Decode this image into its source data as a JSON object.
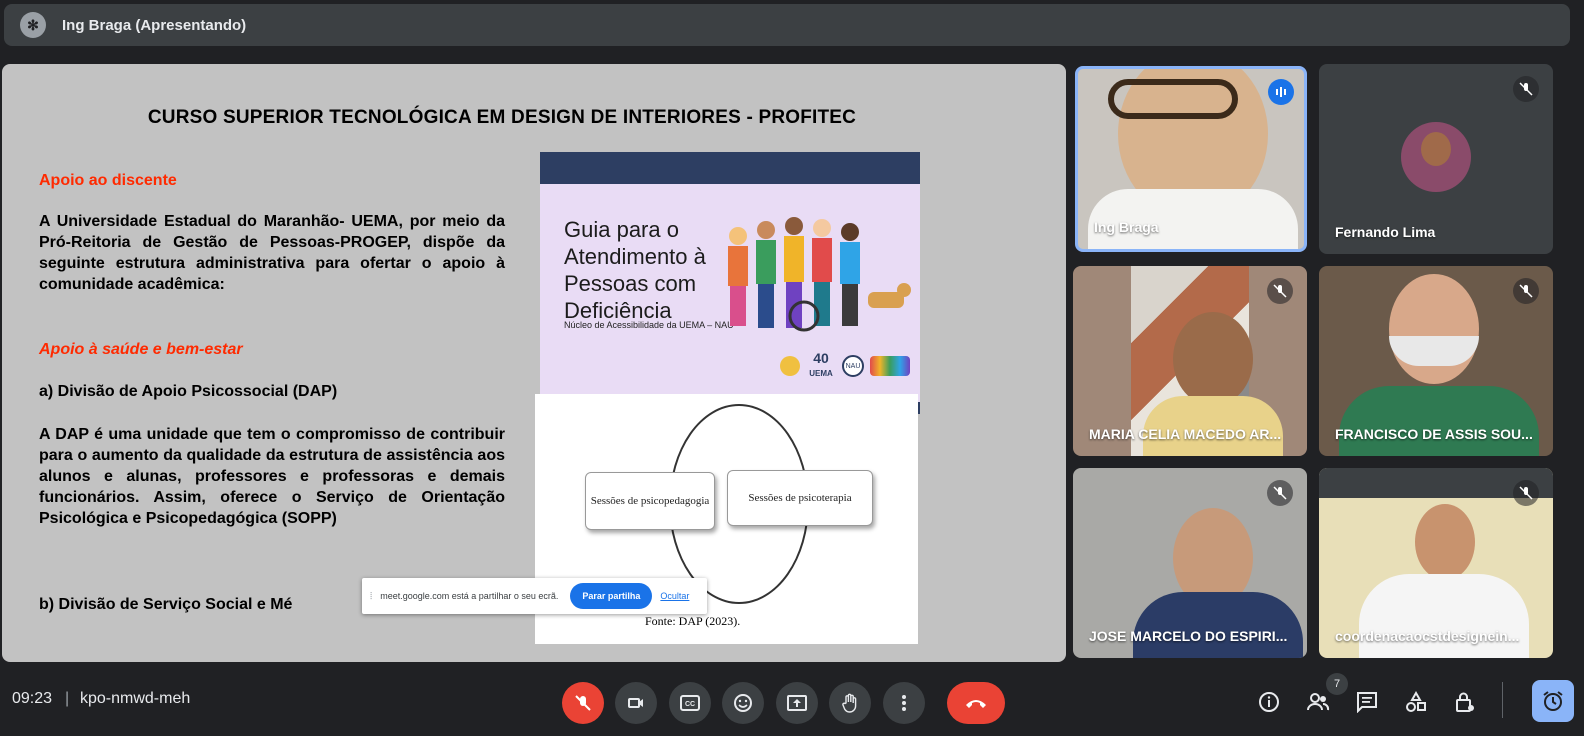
{
  "header": {
    "presenter": "Ing Braga (Apresentando)"
  },
  "slide": {
    "title": "CURSO SUPERIOR TECNOLÓGICA EM DESIGN DE INTERIORES  - PROFITEC",
    "section1": "Apoio ao discente",
    "para1": "A Universidade Estadual do Maranhão- UEMA, por meio da Pró-Reitoria de Gestão de Pessoas-PROGEP, dispõe da seguinte estrutura administrativa para ofertar o apoio à comunidade acadêmica:",
    "section2": "Apoio à saúde e bem-estar",
    "item_a": "a) Divisão de Apoio Psicossocial (DAP)",
    "para2": "A DAP é uma unidade que tem o compromisso de contribuir para o aumento da qualidade da estrutura de assistência aos alunos e alunas, professores e professoras e demais funcionários. Assim, oferece o Serviço de Orientação Psicológica e Psicopedagógica (SOPP)",
    "item_b": "b) Divisão de Serviço Social e Mé",
    "guide_title": "Guia para o\nAtendimento à\nPessoas com\nDeficiência",
    "guide_sub": "Núcleo de Acessibilidade da UEMA – NAU",
    "guide_logo1": "40",
    "guide_logo2": "UEMA",
    "guide_logo3": "NAU",
    "box_left": "Sessões de psicopedagogia",
    "box_right": "Sessões de psicoterapia",
    "fonte": "Fonte: DAP (2023)."
  },
  "share_notice": {
    "message": "meet.google.com está a partilhar o seu ecrã.",
    "stop_label": "Parar partilha",
    "hide_label": "Ocultar"
  },
  "participants": [
    {
      "name": "Ing Braga",
      "speaking": true
    },
    {
      "name": "Fernando Lima",
      "muted": true
    },
    {
      "name": "MARIA CELIA MACEDO AR...",
      "muted": true
    },
    {
      "name": "FRANCISCO DE ASSIS SOU...",
      "muted": true
    },
    {
      "name": "JOSE MARCELO DO ESPIRI...",
      "muted": true
    },
    {
      "name": "coordenacaocstdesignein...",
      "muted": true
    }
  ],
  "bottom": {
    "time": "09:23",
    "separator": "|",
    "meeting_code": "kpo-nmwd-meh",
    "people_count": "7"
  },
  "colors": {
    "accent": "#8ab4f8",
    "danger": "#ea4335",
    "bar": "#202124",
    "tile": "#3c4043"
  }
}
